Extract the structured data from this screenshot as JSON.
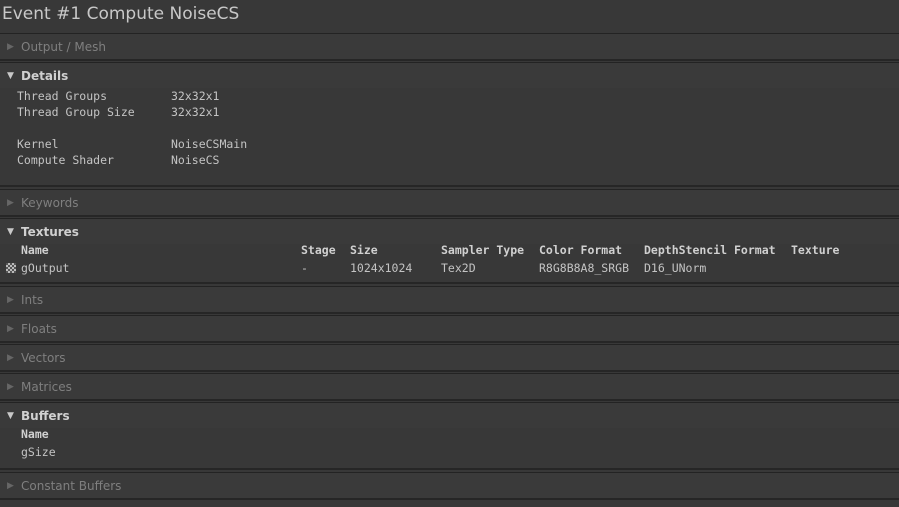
{
  "window": {
    "title": "Event #1 Compute NoiseCS"
  },
  "sections": {
    "output_mesh": {
      "label": "Output / Mesh"
    },
    "details": {
      "label": "Details",
      "rows": [
        {
          "key": "Thread Groups",
          "value": "32x32x1"
        },
        {
          "key": "Thread Group Size",
          "value": "32x32x1"
        },
        {
          "key": "Kernel",
          "value": "NoiseCSMain"
        },
        {
          "key": "Compute Shader",
          "value": "NoiseCS"
        }
      ]
    },
    "keywords": {
      "label": "Keywords"
    },
    "textures": {
      "label": "Textures",
      "columns": [
        "Name",
        "Stage",
        "Size",
        "Sampler Type",
        "Color Format",
        "DepthStencil Format",
        "Texture"
      ],
      "rows": [
        {
          "icon": "texture-icon",
          "name": "gOutput",
          "stage": "-",
          "size": "1024x1024",
          "sampler_type": "Tex2D",
          "color_format": "R8G8B8A8_SRGB",
          "depth_format": "D16_UNorm",
          "texture": ""
        }
      ]
    },
    "ints": {
      "label": "Ints"
    },
    "floats": {
      "label": "Floats"
    },
    "vectors": {
      "label": "Vectors"
    },
    "matrices": {
      "label": "Matrices"
    },
    "buffers": {
      "label": "Buffers",
      "columns": [
        "Name"
      ],
      "rows": [
        {
          "name": "gSize"
        }
      ]
    },
    "constant_buffers": {
      "label": "Constant Buffers"
    }
  },
  "icons": {
    "collapsed": "▶",
    "expanded": "▼"
  }
}
